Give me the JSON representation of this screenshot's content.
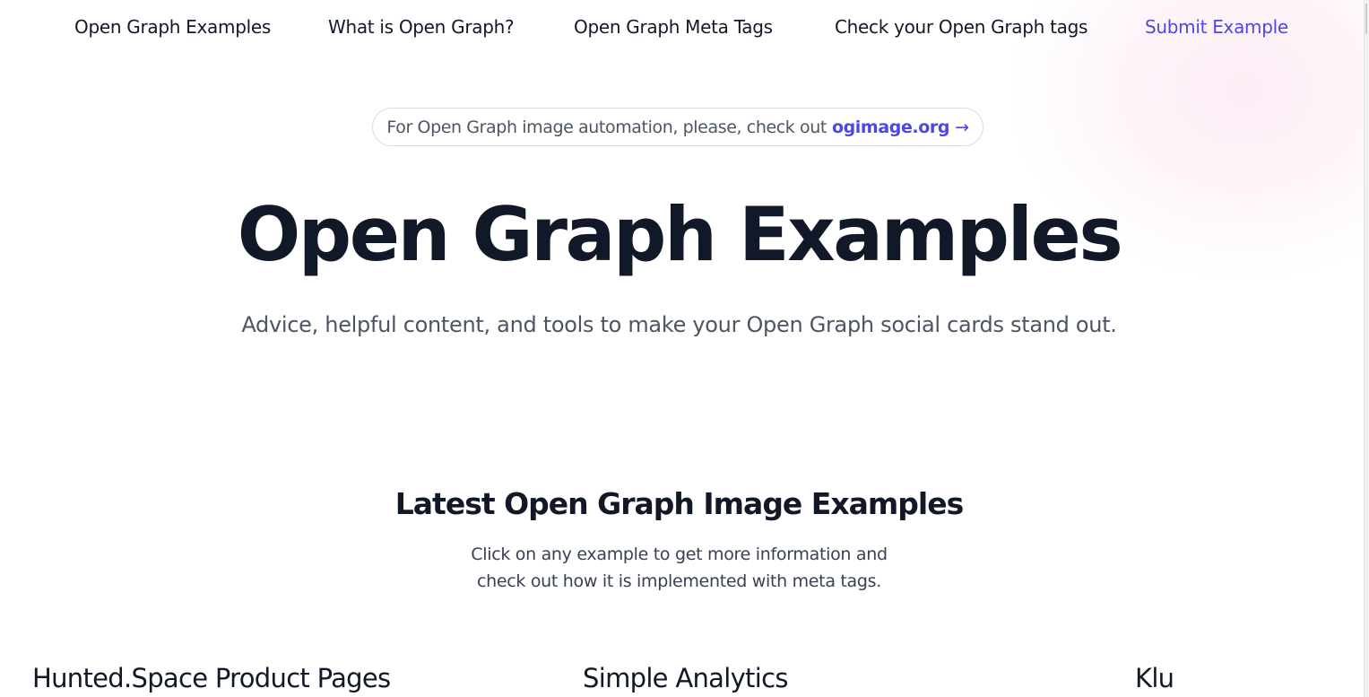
{
  "nav": {
    "items": [
      {
        "label": "Open Graph Examples"
      },
      {
        "label": "What is Open Graph?"
      },
      {
        "label": "Open Graph Meta Tags"
      },
      {
        "label": "Check your Open Graph tags"
      },
      {
        "label": "Submit Example"
      }
    ]
  },
  "banner": {
    "text": "For Open Graph image automation, please, check out",
    "link_label": "ogimage.org",
    "arrow": "→"
  },
  "hero": {
    "title": "Open Graph Examples",
    "subtitle": "Advice, helpful content, and tools to make your Open Graph social cards stand out."
  },
  "latest": {
    "title": "Latest Open Graph Image Examples",
    "description_line1": "Click on any example to get more information and",
    "description_line2": "check out how it is implemented with meta tags."
  },
  "examples": [
    {
      "title": "Hunted.Space Product Pages"
    },
    {
      "title": "Simple Analytics"
    },
    {
      "title": "Klu"
    }
  ],
  "colors": {
    "accent": "#4f46e5",
    "heading": "#111827",
    "muted": "#4b5563"
  }
}
